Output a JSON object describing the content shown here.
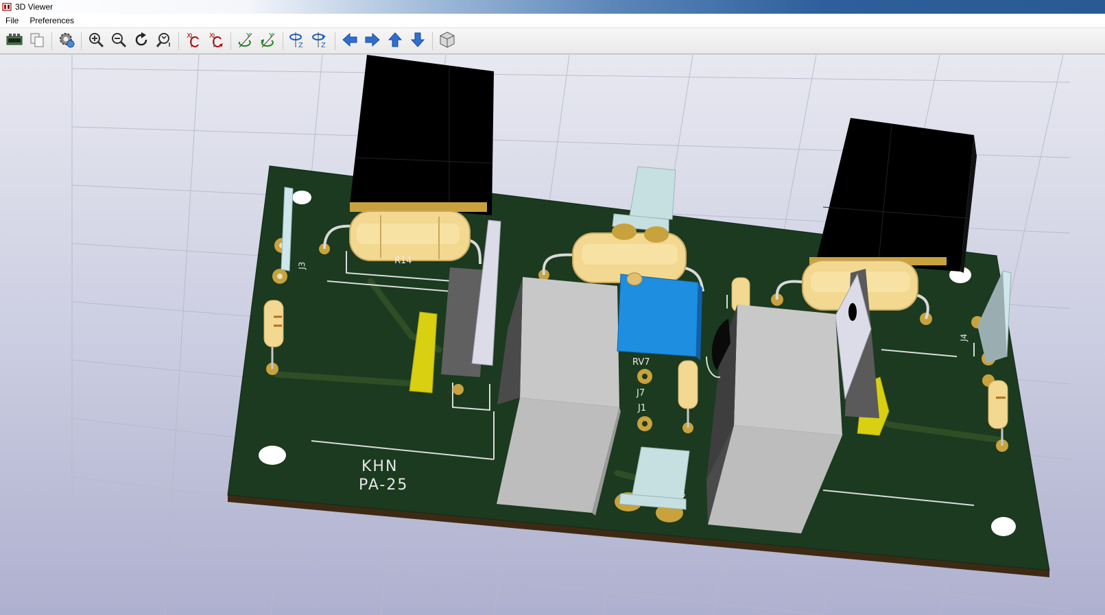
{
  "window": {
    "title": "3D Viewer",
    "icon": "kicad-3d-icon"
  },
  "menu": {
    "file": "File",
    "preferences": "Preferences"
  },
  "toolbar": {
    "buttons": [
      "reload-board-icon",
      "copy-icon",
      "settings-icon",
      "zoom-in-icon",
      "zoom-out-icon",
      "redraw-icon",
      "zoom-fit-icon",
      "rotate-x-cw-icon",
      "rotate-x-ccw-icon",
      "rotate-y-cw-icon",
      "rotate-y-ccw-icon",
      "rotate-z-cw-icon",
      "rotate-z-ccw-icon",
      "pan-left-icon",
      "pan-right-icon",
      "pan-up-icon",
      "pan-down-icon",
      "ortho-view-icon"
    ]
  },
  "board": {
    "silkscreen_title_1": "KHN",
    "silkscreen_title_2": "PA-25",
    "refs": {
      "r14": "R14",
      "rv7": "RV7",
      "j7": "J7",
      "j1": "J1",
      "j3": "J3",
      "j4": "J4",
      "partial": "5"
    }
  },
  "colors": {
    "pcb": "#1b3a1f",
    "pcb_edge": "#3e2a14",
    "pad": "#c8a23c",
    "silk": "#e8e8e8",
    "resistor": "#f2d890",
    "heatsink": "#000000",
    "trimmer": "#1e8ee0"
  }
}
